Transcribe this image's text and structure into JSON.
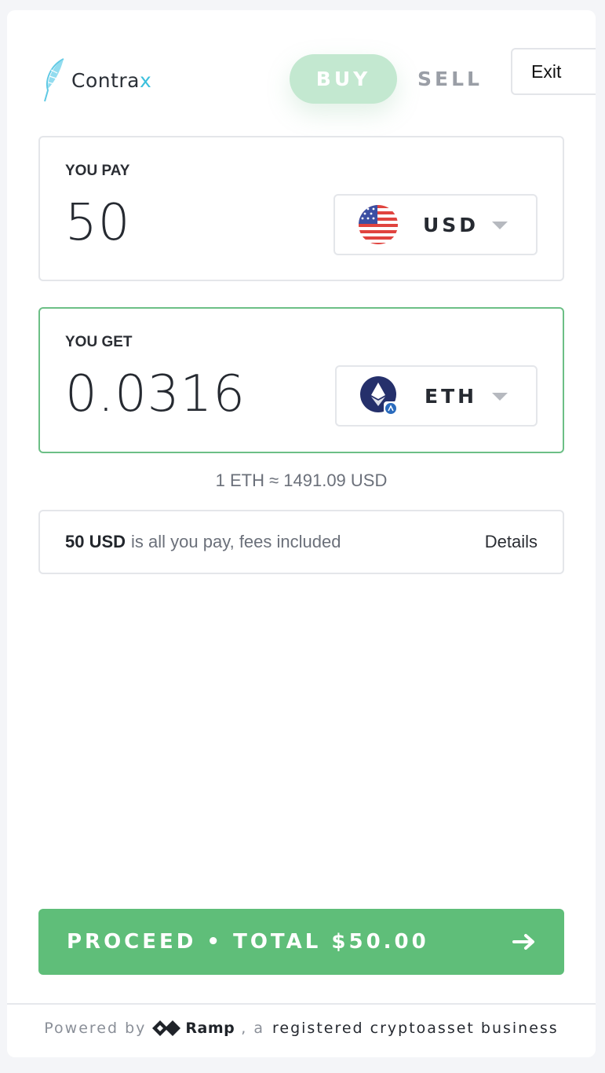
{
  "header": {
    "logo_text": "Contra",
    "logo_text_accent": "x",
    "modes": {
      "buy": "BUY",
      "sell": "SELL",
      "active": "buy"
    },
    "exit_label": "Exit"
  },
  "pay": {
    "label": "YOU PAY",
    "amount": "50",
    "currency": "USD",
    "currency_icon": "us-flag-icon"
  },
  "get": {
    "label": "YOU GET",
    "amount": "0.0316",
    "currency": "ETH",
    "currency_icon": "ethereum-icon"
  },
  "rate": "1 ETH ≈ 1491.09 USD",
  "fees": {
    "amount": "50 USD",
    "text": "is all you pay, fees included",
    "details_label": "Details"
  },
  "proceed": {
    "label": "PROCEED • TOTAL $50.00",
    "icon": "arrow-right-icon"
  },
  "footer": {
    "prefix": "Powered by",
    "brand": "Ramp",
    "suffix_light": ", a",
    "suffix": "registered cryptoasset business"
  },
  "colors": {
    "accent": "#5fbe79",
    "buy_pill": "#c3e8d0",
    "active_border": "#6cbf86",
    "logo_accent": "#3cc0dd"
  }
}
